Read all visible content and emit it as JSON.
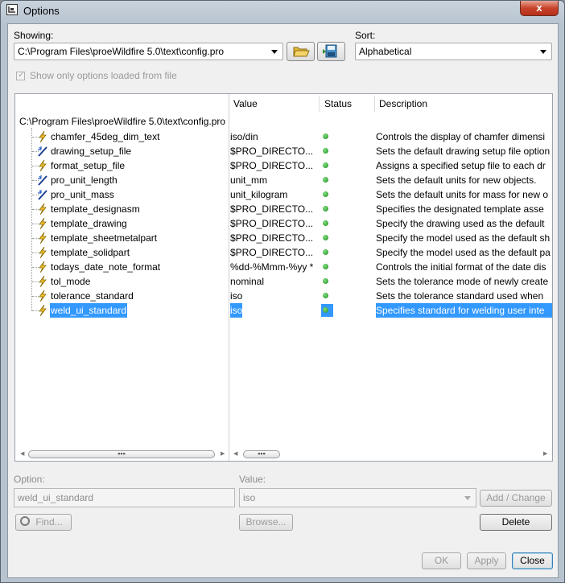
{
  "window": {
    "title": "Options",
    "close_label": "x"
  },
  "showing": {
    "label": "Showing:",
    "value": "C:\\Program Files\\proeWildfire 5.0\\text\\config.pro"
  },
  "sort": {
    "label": "Sort:",
    "value": "Alphabetical"
  },
  "show_only_checkbox": {
    "label": "Show only options loaded from file",
    "checked": true,
    "enabled": false
  },
  "table": {
    "columns": [
      "Value",
      "Status",
      "Description"
    ],
    "root": "C:\\Program Files\\proeWildfire 5.0\\text\\config.pro",
    "rows": [
      {
        "name": "chamfer_45deg_dim_text",
        "value": "iso/din",
        "icon": "lightning-icon",
        "description": "Controls the display of chamfer dimensi"
      },
      {
        "name": "drawing_setup_file",
        "value": "$PRO_DIRECTO...",
        "icon": "magic-wand-icon",
        "description": "Sets the default drawing setup file option"
      },
      {
        "name": "format_setup_file",
        "value": "$PRO_DIRECTO...",
        "icon": "lightning-icon",
        "description": "Assigns a specified setup file to each dr"
      },
      {
        "name": "pro_unit_length",
        "value": "unit_mm",
        "icon": "magic-wand-icon",
        "description": "Sets the default units for new objects."
      },
      {
        "name": "pro_unit_mass",
        "value": "unit_kilogram",
        "icon": "magic-wand-icon",
        "description": "Sets the default units for mass for new o"
      },
      {
        "name": "template_designasm",
        "value": "$PRO_DIRECTO...",
        "icon": "lightning-icon",
        "description": "Specifies the designated template asse"
      },
      {
        "name": "template_drawing",
        "value": "$PRO_DIRECTO...",
        "icon": "lightning-icon",
        "description": "Specify the drawing used as the default"
      },
      {
        "name": "template_sheetmetalpart",
        "value": "$PRO_DIRECTO...",
        "icon": "lightning-icon",
        "description": "Specify the model used as the default sh"
      },
      {
        "name": "template_solidpart",
        "value": "$PRO_DIRECTO...",
        "icon": "lightning-icon",
        "description": "Specify the model used as the default pa"
      },
      {
        "name": "todays_date_note_format",
        "value": "%dd-%Mmm-%yy *",
        "icon": "lightning-icon",
        "description": "Controls the initial format of the date dis"
      },
      {
        "name": "tol_mode",
        "value": "nominal",
        "icon": "lightning-icon",
        "description": "Sets the tolerance mode of newly create"
      },
      {
        "name": "tolerance_standard",
        "value": "iso",
        "icon": "lightning-icon",
        "description": "Sets the tolerance standard used when"
      },
      {
        "name": "weld_ui_standard",
        "value": "iso",
        "icon": "lightning-icon",
        "description": "Specifies standard for welding user inte",
        "selected": true
      }
    ]
  },
  "option_field": {
    "label": "Option:",
    "value": "weld_ui_standard"
  },
  "value_field": {
    "label": "Value:",
    "value": "iso"
  },
  "buttons": {
    "add_change": "Add / Change",
    "find": "Find...",
    "browse": "Browse...",
    "delete": "Delete",
    "ok": "OK",
    "apply": "Apply",
    "close": "Close"
  },
  "colors": {
    "selection": "#3399ff",
    "status_ok": "#2ea82e",
    "close_button": "#c7432b"
  }
}
